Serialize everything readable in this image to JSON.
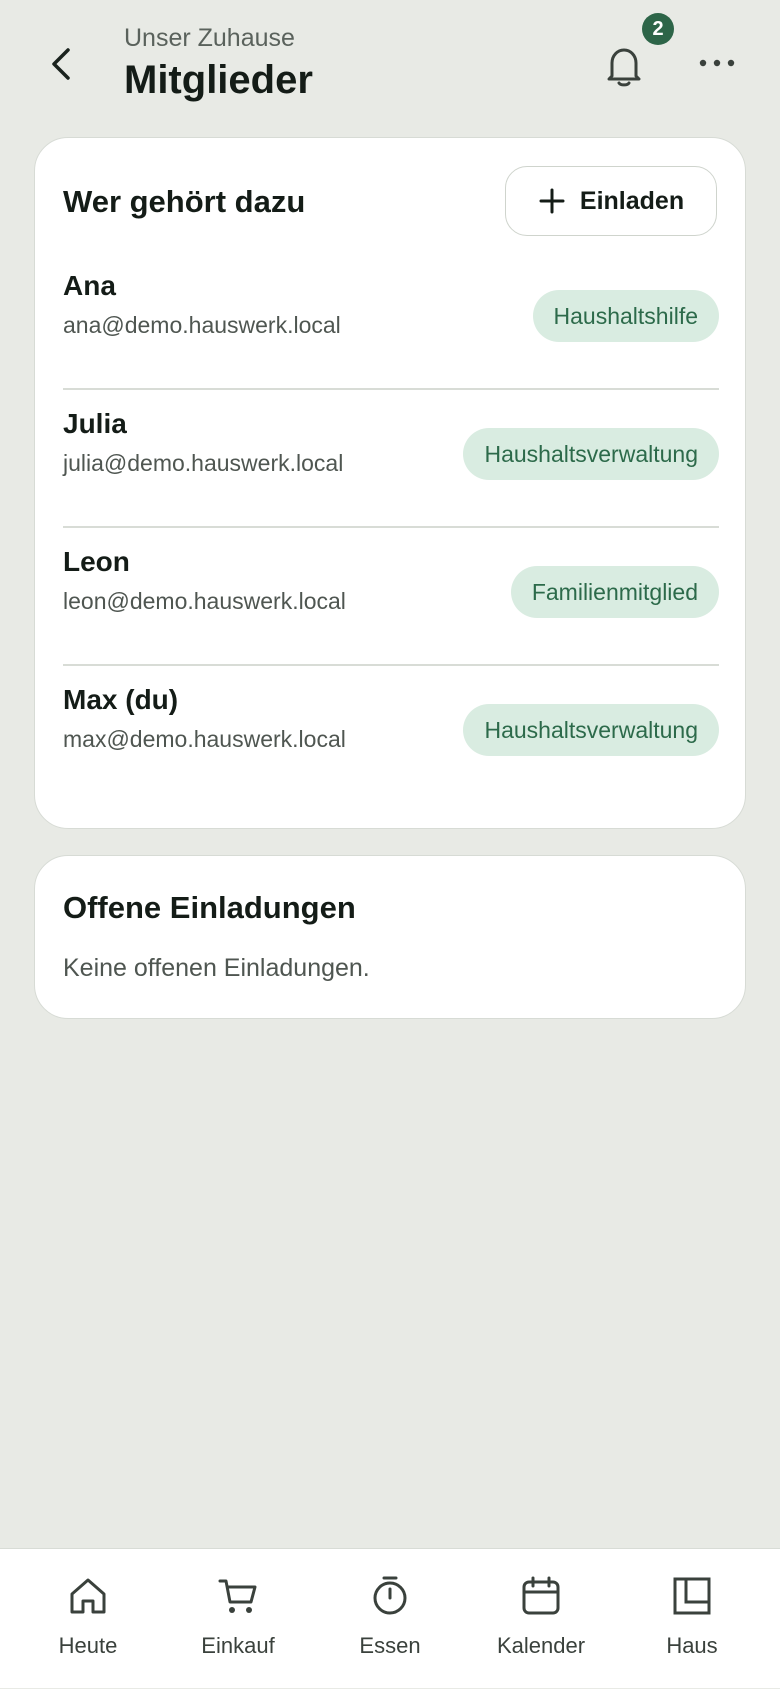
{
  "header": {
    "subtitle": "Unser Zuhause",
    "title": "Mitglieder",
    "notification_count": "2"
  },
  "members_card": {
    "title": "Wer gehört dazu",
    "invite_label": "Einladen",
    "members": [
      {
        "name": "Ana",
        "email": "ana@demo.hauswerk.local",
        "role": "Haushaltshilfe"
      },
      {
        "name": "Julia",
        "email": "julia@demo.hauswerk.local",
        "role": "Haushaltsverwaltung"
      },
      {
        "name": "Leon",
        "email": "leon@demo.hauswerk.local",
        "role": "Familienmitglied"
      },
      {
        "name": "Max (du)",
        "email": "max@demo.hauswerk.local",
        "role": "Haushaltsverwaltung"
      }
    ]
  },
  "invites_card": {
    "title": "Offene Einladungen",
    "empty_text": "Keine offenen Einladungen."
  },
  "bottom_nav": {
    "items": [
      {
        "label": "Heute",
        "icon": "home-icon"
      },
      {
        "label": "Einkauf",
        "icon": "cart-icon"
      },
      {
        "label": "Essen",
        "icon": "timer-icon"
      },
      {
        "label": "Kalender",
        "icon": "calendar-icon"
      },
      {
        "label": "Haus",
        "icon": "layout-icon"
      }
    ]
  },
  "colors": {
    "background": "#e8eae5",
    "accent": "#2d6548",
    "pill_bg": "#d9ece1",
    "pill_text": "#2c6a4a"
  }
}
